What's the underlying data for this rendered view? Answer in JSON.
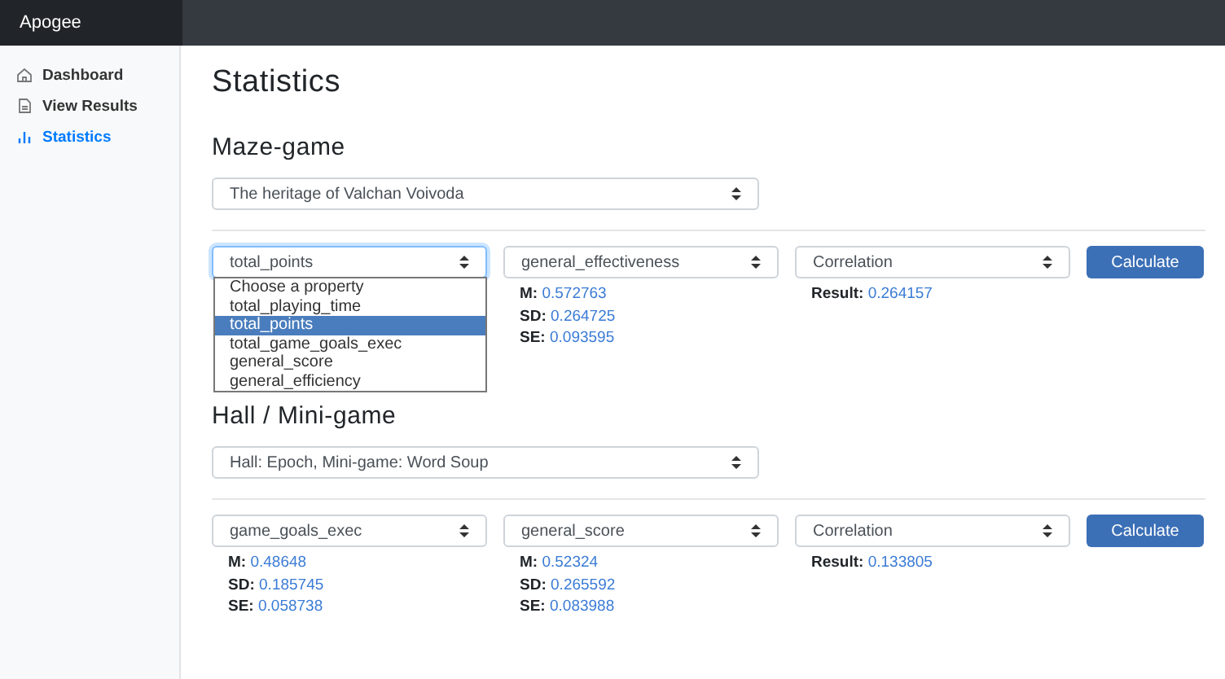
{
  "brand": "Apogee",
  "sidebar": {
    "items": [
      {
        "label": "Dashboard",
        "selected": false
      },
      {
        "label": "View Results",
        "selected": false
      },
      {
        "label": "Statistics",
        "selected": true
      }
    ]
  },
  "page_title": "Statistics",
  "sections": [
    {
      "title": "Maze-game",
      "select": "The heritage of Valchan Voivoda",
      "fields": [
        {
          "value": "total_points",
          "open": true,
          "options": [
            {
              "label": "Choose a property",
              "selected": false
            },
            {
              "label": "total_playing_time",
              "selected": false
            },
            {
              "label": "total_points",
              "selected": true
            },
            {
              "label": "total_game_goals_exec",
              "selected": false
            },
            {
              "label": "general_score",
              "selected": false
            },
            {
              "label": "general_efficiency",
              "selected": false
            }
          ]
        },
        {
          "value": "general_effectiveness",
          "open": false,
          "stats": [
            {
              "label": "M:",
              "value": "0.572763"
            },
            {
              "label": "SD:",
              "value": "0.264725"
            },
            {
              "label": "SE:",
              "value": "0.093595"
            }
          ]
        }
      ],
      "method": "Correlation",
      "result": {
        "label": "Result:",
        "value": "0.264157"
      },
      "button": "Calculate"
    },
    {
      "title": "Hall / Mini-game",
      "select": "Hall: Epoch, Mini-game: Word Soup",
      "fields": [
        {
          "value": "game_goals_exec",
          "open": false,
          "stats": [
            {
              "label": "M:",
              "value": "0.48648"
            },
            {
              "label": "SD:",
              "value": "0.185745"
            },
            {
              "label": "SE:",
              "value": "0.058738"
            }
          ]
        },
        {
          "value": "general_score",
          "open": false,
          "stats": [
            {
              "label": "M:",
              "value": "0.52324"
            },
            {
              "label": "SD:",
              "value": "0.265592"
            },
            {
              "label": "SE:",
              "value": "0.083988"
            }
          ]
        }
      ],
      "method": "Correlation",
      "result": {
        "label": "Result:",
        "value": "0.133805"
      },
      "button": "Calculate"
    }
  ]
}
